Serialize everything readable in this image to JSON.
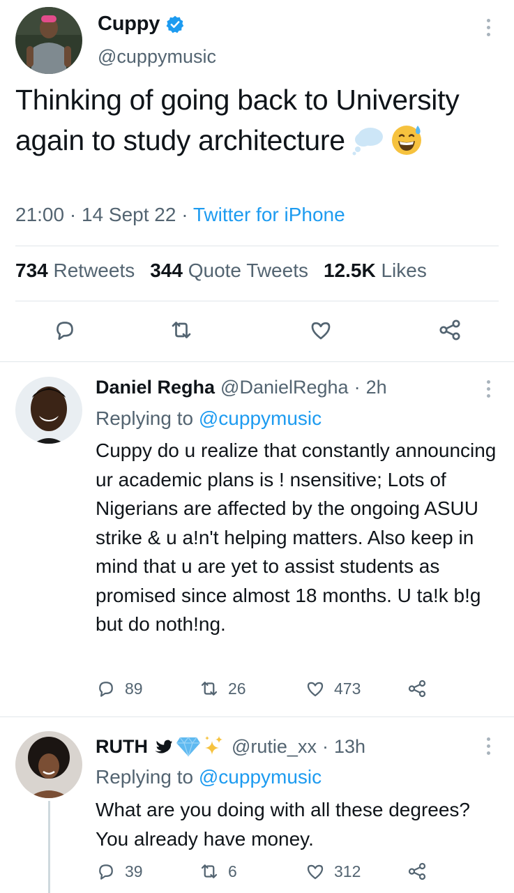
{
  "main_tweet": {
    "display_name": "Cuppy",
    "handle": "@cuppymusic",
    "text": "Thinking of going back to University again to study architecture",
    "time": "21:00",
    "date": "14 Sept 22",
    "source": "Twitter for iPhone",
    "separator": "·",
    "stats": [
      {
        "count": "734",
        "label": "Retweets"
      },
      {
        "count": "344",
        "label": "Quote Tweets"
      },
      {
        "count": "12.5K",
        "label": "Likes"
      }
    ],
    "icons": {
      "verified": "verified-badge-icon",
      "emoji_1": "thought-balloon-emoji",
      "emoji_2": "grinning-sweat-emoji",
      "actions": [
        "reply-icon",
        "retweet-icon",
        "like-icon",
        "share-icon"
      ]
    }
  },
  "replies": [
    {
      "display_name": "Daniel Regha",
      "handle": "@DanielRegha",
      "separator": "·",
      "time": "2h",
      "replying_prefix": "Replying to",
      "replying_to": "@cuppymusic",
      "text": "Cuppy do u realize that constantly announcing ur academic plans is ! nsensitive; Lots of Nigerians are affected by the ongoing ASUU strike & u a!n't helping matters. Also keep in mind that u are yet to assist students as promised since almost 18 months. U ta!k b!g but do noth!ng.",
      "reply_count": "89",
      "retweet_count": "26",
      "like_count": "473"
    },
    {
      "display_name": "RUTH",
      "name_emojis": [
        "bird-emoji",
        "gem-emoji",
        "sparkles-emoji"
      ],
      "handle": "@rutie_xx",
      "separator": "·",
      "time": "13h",
      "replying_prefix": "Replying to",
      "replying_to": "@cuppymusic",
      "text": "What are you doing with all these degrees? You already have money.",
      "reply_count": "39",
      "retweet_count": "6",
      "like_count": "312"
    }
  ],
  "colors": {
    "accent": "#1d9bf0",
    "text_primary": "#0f1419",
    "text_secondary": "#536471",
    "divider": "#e1e6ea"
  }
}
